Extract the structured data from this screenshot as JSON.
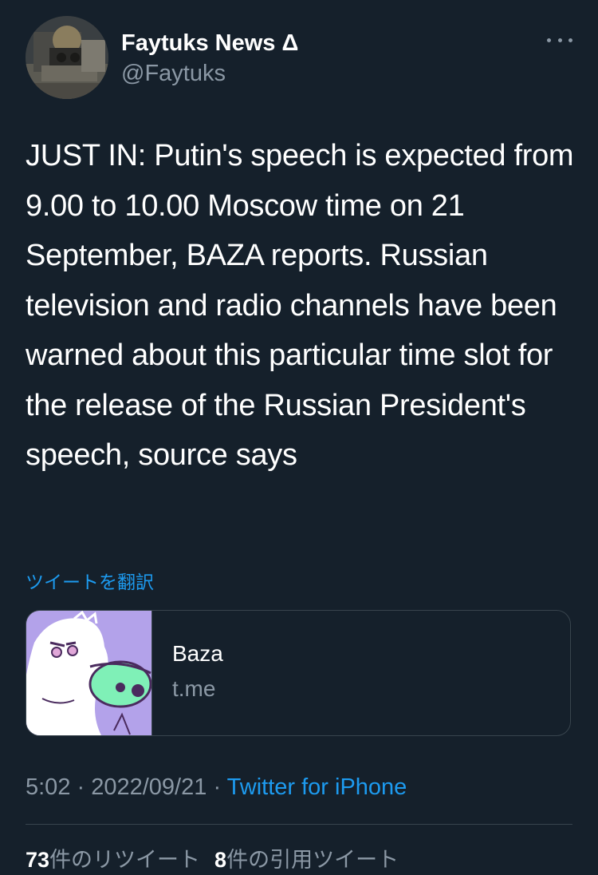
{
  "tweet": {
    "author": {
      "display_name": "Faytuks News Δ",
      "handle": "@Faytuks"
    },
    "text": "JUST IN: Putin's speech is expected from 9.00 to 10.00 Moscow time on 21 September, BAZA reports. Russian television and radio channels have been warned about this particular time slot for the release of the Russian President's speech, source says",
    "translate_label": "ツイートを翻訳",
    "card": {
      "title": "Baza",
      "domain": "t.me"
    },
    "meta": {
      "time": "5:02",
      "separator": " · ",
      "date": "2022/09/21",
      "source": "Twitter for iPhone"
    },
    "stats": {
      "retweets_count": "73",
      "retweets_label": "件のリツイート",
      "quotes_count": "8",
      "quotes_label": "件の引用ツイート"
    }
  },
  "colors": {
    "background": "#15202b",
    "text": "#ffffff",
    "secondary_text": "#8b98a5",
    "accent": "#1d9bf0",
    "border": "#38444d"
  },
  "icons": {
    "more": "more-dots-icon"
  }
}
